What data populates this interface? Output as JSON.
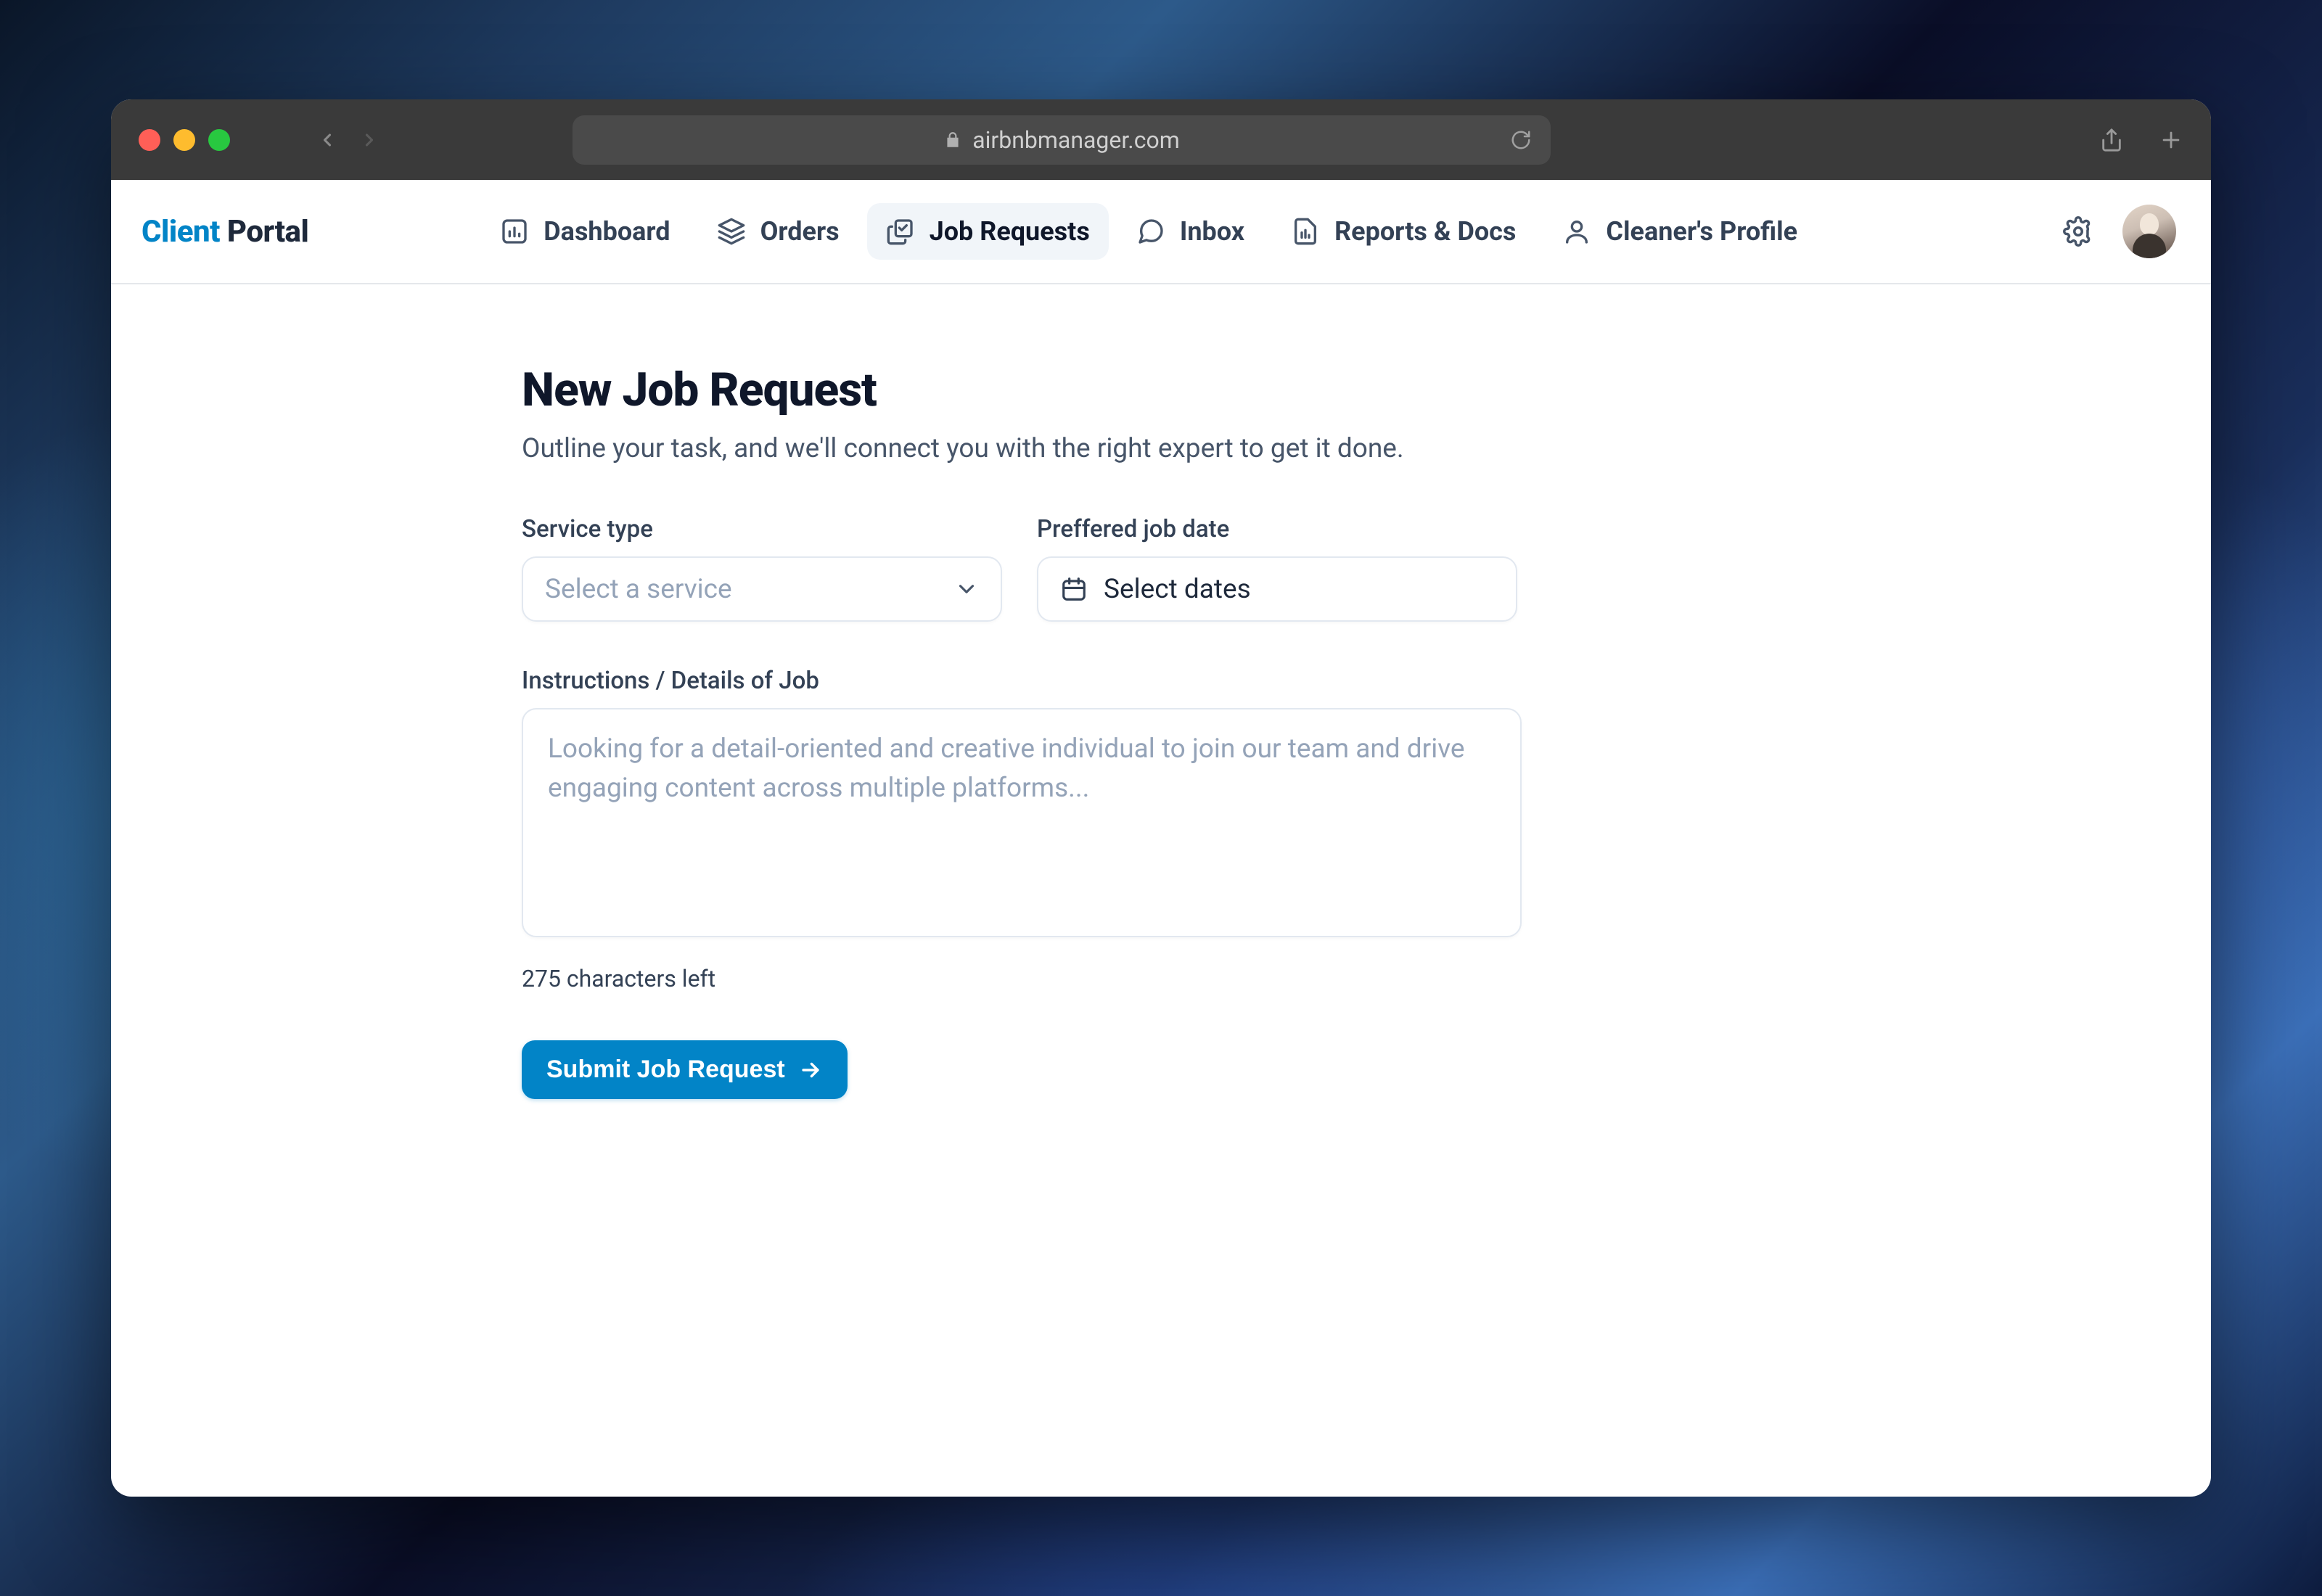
{
  "browser": {
    "url": "airbnbmanager.com"
  },
  "brand": {
    "part1": "Client",
    "part2": "Portal"
  },
  "nav": {
    "items": [
      {
        "label": "Dashboard"
      },
      {
        "label": "Orders"
      },
      {
        "label": "Job Requests"
      },
      {
        "label": "Inbox"
      },
      {
        "label": "Reports & Docs"
      },
      {
        "label": "Cleaner's Profile"
      }
    ]
  },
  "page": {
    "title": "New Job Request",
    "subtitle": "Outline your task, and we'll connect you with the right expert to get it done."
  },
  "form": {
    "service_type_label": "Service type",
    "service_type_placeholder": "Select a service",
    "date_label": "Preffered job date",
    "date_placeholder": "Select dates",
    "instructions_label": "Instructions / Details of Job",
    "instructions_placeholder": "Looking for a detail-oriented and creative individual to join our team and drive engaging content across multiple platforms...",
    "char_counter": "275 characters left",
    "submit_label": "Submit Job Request"
  }
}
